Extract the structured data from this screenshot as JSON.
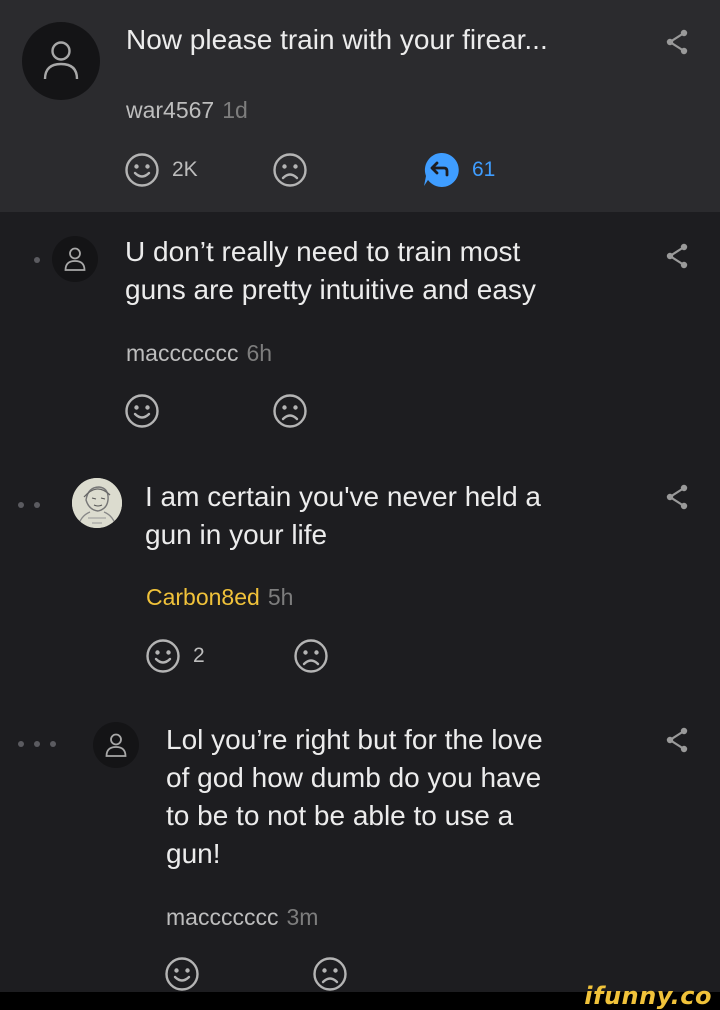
{
  "post": {
    "title": "Now please train with your firear...",
    "user": "war4567",
    "age": "1d",
    "smiles": "2K",
    "replies": "61"
  },
  "comments": [
    {
      "text_lines": [
        "U don’t really need to train most",
        "guns are pretty intuitive and easy"
      ],
      "user": "maccccccc",
      "age": "6h",
      "smiles": ""
    },
    {
      "text_lines": [
        "I am certain you've never held a",
        "gun in your life"
      ],
      "user": "Carbon8ed",
      "age": "5h",
      "smiles": "2"
    },
    {
      "text_lines": [
        "Lol you’re right but for the love",
        "of god how dumb do you have",
        "to be to not be able to use a",
        "gun!"
      ],
      "user": "maccccccc",
      "age": "3m",
      "smiles": ""
    }
  ],
  "watermark": "ifunny.co",
  "colors": {
    "background": "#1d1d20",
    "header_background": "#2b2b2e",
    "highlight_username": "#f0c23a",
    "reply_accent": "#3f9dff"
  },
  "icons": [
    "user-placeholder-icon",
    "smile-icon",
    "frown-icon",
    "reply-icon",
    "share-icon",
    "thread-depth-dot"
  ]
}
